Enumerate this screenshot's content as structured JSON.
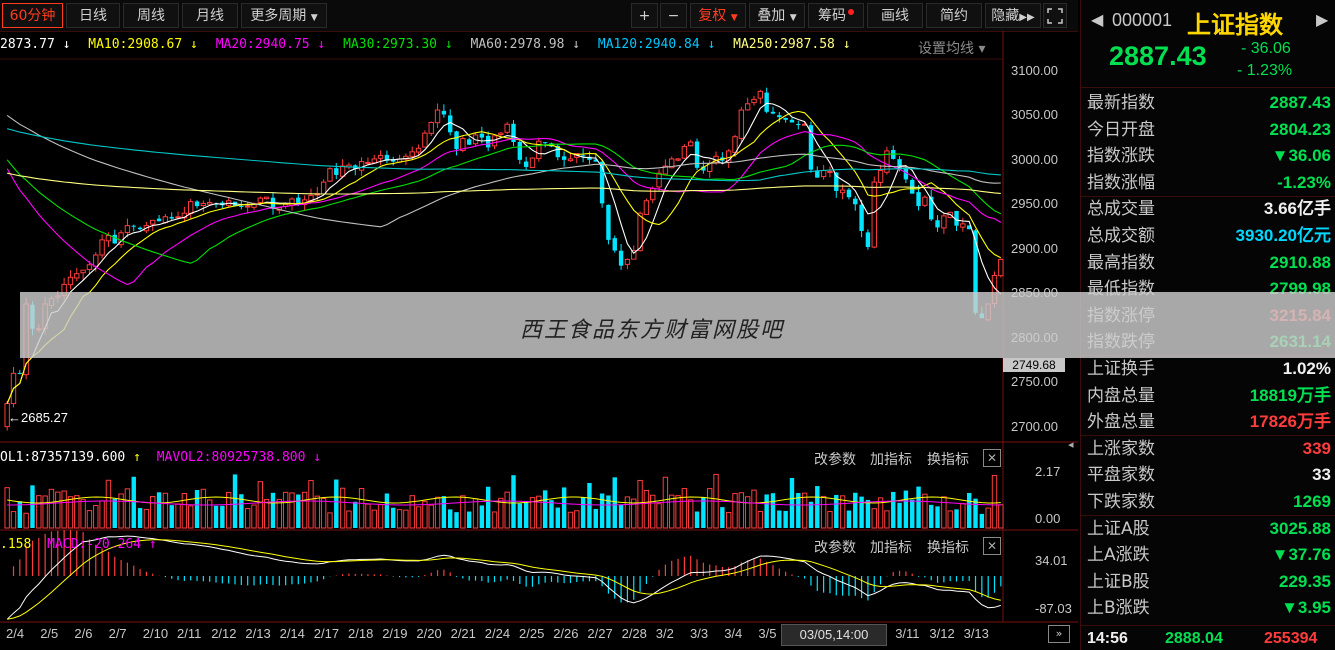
{
  "toolbar": {
    "periods": [
      {
        "label": "60分钟",
        "active": true
      },
      {
        "label": "日线",
        "active": false
      },
      {
        "label": "周线",
        "active": false
      },
      {
        "label": "月线",
        "active": false
      },
      {
        "label": "更多周期",
        "active": false
      }
    ],
    "plus": "+",
    "minus": "−",
    "fuquan": "复权",
    "diejia": "叠加",
    "chouma": "筹码",
    "huaxian": "画线",
    "jianyue": "简约",
    "yincang": "隐藏",
    "fullscreen_icon": "fullscreen-icon"
  },
  "ma_legend": {
    "ma5": "2873.77",
    "ma10_label": "MA10:2908.67",
    "ma20_label": "MA20:2940.75",
    "ma30_label": "MA30:2973.30",
    "ma60_label": "MA60:2978.98",
    "ma120_label": "MA120:2940.84",
    "ma250_label": "MA250:2987.58",
    "settings": "设置均线"
  },
  "colors": {
    "up": "#ff3c3c",
    "down": "#00e5ff",
    "ma5": "#ffffff",
    "ma10": "#ffff00",
    "ma20": "#ff00ff",
    "ma30": "#00e000",
    "ma60": "#c0c0c0",
    "ma120": "#00c8c8",
    "ma250": "#ffff80"
  },
  "chart_data": {
    "type": "candlestick",
    "y_ticks": [
      "3100.00",
      "3050.00",
      "3000.00",
      "2950.00",
      "2900.00",
      "2850.00",
      "2800.00",
      "2750.00",
      "2700.00"
    ],
    "ylim": [
      2685,
      3110
    ],
    "x_labels": [
      "2/4",
      "2/5",
      "2/6",
      "2/7",
      "2/10",
      "2/11",
      "2/12",
      "2/13",
      "2/14",
      "2/17",
      "2/18",
      "2/19",
      "2/20",
      "2/21",
      "2/24",
      "2/25",
      "2/26",
      "2/27",
      "2/28",
      "3/2",
      "3/3",
      "3/4",
      "3/5",
      "3/6",
      "3/9",
      "3/10",
      "3/11",
      "3/12",
      "3/13"
    ],
    "annotations": {
      "low": "2685.27",
      "current_price": "2749.68"
    },
    "close": [
      2726,
      2760,
      2760,
      2838,
      2810,
      2810,
      2838,
      2844,
      2847,
      2860,
      2868,
      2872,
      2876,
      2882,
      2893,
      2910,
      2915,
      2906,
      2918,
      2926,
      2925,
      2922,
      2926,
      2932,
      2931,
      2936,
      2934,
      2936,
      2940,
      2953,
      2948,
      2951,
      2952,
      2950,
      2949,
      2954,
      2948,
      2948,
      2948,
      2951,
      2957,
      2958,
      2945,
      2946,
      2950,
      2956,
      2950,
      2955,
      2960,
      2962,
      2975,
      2990,
      2983,
      2993,
      2994,
      2990,
      2998,
      2997,
      3001,
      3005,
      2999,
      2998,
      3001,
      3004,
      3009,
      3013,
      3030,
      3042,
      3056,
      3051,
      3031,
      3012,
      3024,
      3017,
      3028,
      3025,
      3014,
      3027,
      3030,
      3040,
      3020,
      3000,
      2992,
      3002,
      3021,
      3019,
      3015,
      3003,
      3000,
      3001,
      3007,
      3004,
      3000,
      2998,
      2951,
      2910,
      2898,
      2881,
      2888,
      2898,
      2940,
      2954,
      2968,
      2985,
      2993,
      3001,
      3001,
      3015,
      3020,
      2991,
      2988,
      2996,
      3004,
      2999,
      3010,
      3026,
      3056,
      3063,
      3068,
      3077,
      3054,
      3052,
      3048,
      3045,
      3042,
      3040,
      3040,
      2989,
      2980,
      2988,
      2987,
      2965,
      2966,
      2958,
      2950,
      2920,
      2902,
      2975,
      2988,
      3010,
      3001,
      2990,
      2978,
      2962,
      2948,
      2958,
      2933,
      2924,
      2937,
      2941,
      2926,
      2928,
      2922,
      2828,
      2822,
      2838,
      2870,
      2888
    ],
    "ma_series_note": "MA lines computed client-side"
  },
  "volume_panel": {
    "label1": "OL1:87357139.600",
    "label2": "MAVOL2:80925738.800",
    "btn1": "改参数",
    "btn2": "加指标",
    "btn3": "换指标",
    "y_ticks": [
      "2.17",
      "0.00"
    ]
  },
  "macd_panel": {
    "label1": ".158",
    "label2": "MACD:-20.264",
    "btn1": "改参数",
    "btn2": "加指标",
    "btn3": "换指标",
    "y_ticks": [
      "34.01",
      "-87.03"
    ]
  },
  "cursor_time": "03/05,14:00",
  "watermark": "西王食品东方财富网股吧",
  "quote": {
    "code": "000001",
    "name": "上证指数",
    "price": "2887.43",
    "change": "- 36.06",
    "change_pct": "- 1.23%",
    "rows": [
      {
        "label": "最新指数",
        "value": "2887.43",
        "color": "green"
      },
      {
        "label": "今日开盘",
        "value": "2804.23",
        "color": "green"
      },
      {
        "label": "指数涨跌",
        "value": "▼36.06",
        "color": "green"
      },
      {
        "label": "指数涨幅",
        "value": "-1.23%",
        "color": "green"
      },
      {
        "label": "总成交量",
        "value": "3.66亿手",
        "color": "white"
      },
      {
        "label": "总成交额",
        "value": "3930.20亿元",
        "color": "cyan"
      },
      {
        "label": "最高指数",
        "value": "2910.88",
        "color": "green"
      },
      {
        "label": "最低指数",
        "value": "2799.98",
        "color": "green"
      },
      {
        "label": "指数涨停",
        "value": "3215.84",
        "color": "red"
      },
      {
        "label": "指数跌停",
        "value": "2631.14",
        "color": "green"
      },
      {
        "label": "上证换手",
        "value": "1.02%",
        "color": "white"
      },
      {
        "label": "内盘总量",
        "value": "18819万手",
        "color": "green"
      },
      {
        "label": "外盘总量",
        "value": "17826万手",
        "color": "red"
      },
      {
        "label": "上涨家数",
        "value": "339",
        "color": "red"
      },
      {
        "label": "平盘家数",
        "value": "33",
        "color": "white"
      },
      {
        "label": "下跌家数",
        "value": "1269",
        "color": "green"
      },
      {
        "label": "上证A股",
        "value": "3025.88",
        "color": "green"
      },
      {
        "label": "上A涨跌",
        "value": "▼37.76",
        "color": "green"
      },
      {
        "label": "上证B股",
        "value": "229.35",
        "color": "green"
      },
      {
        "label": "上B涨跌",
        "value": "▼3.95",
        "color": "green"
      }
    ],
    "footer": {
      "time": "14:56",
      "price": "2888.04",
      "volume": "255394"
    }
  }
}
